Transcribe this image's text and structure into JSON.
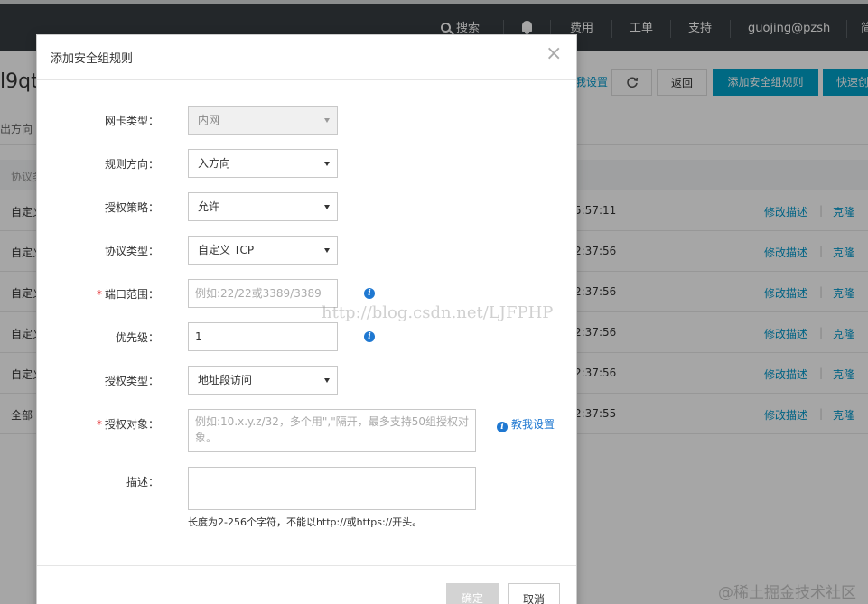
{
  "topbar": {
    "search": "搜索",
    "cost": "费用",
    "ticket": "工单",
    "support": "支持",
    "user": "guojing@pzsh",
    "extra": "简"
  },
  "background": {
    "title_fragment": "l9qt",
    "tab_fragment": "出方向",
    "thead_fragment": "协议类",
    "toolbar": {
      "settings_link": "我设置",
      "back": "返回",
      "add_rule": "添加安全组规则",
      "quick": "快速创"
    },
    "rows": [
      {
        "c1": "自定义",
        "time": "5:57:11",
        "edit": "修改描述",
        "clone": "克隆"
      },
      {
        "c1": "自定义",
        "time": "2:37:56",
        "edit": "修改描述",
        "clone": "克隆"
      },
      {
        "c1": "自定义",
        "time": "2:37:56",
        "edit": "修改描述",
        "clone": "克隆"
      },
      {
        "c1": "自定义",
        "time": "2:37:56",
        "edit": "修改描述",
        "clone": "克隆"
      },
      {
        "c1": "自定义",
        "time": "2:37:56",
        "edit": "修改描述",
        "clone": "克隆"
      },
      {
        "c1": "全部",
        "time": "2:37:55",
        "edit": "修改描述",
        "clone": "克隆"
      }
    ],
    "separator": "|"
  },
  "modal": {
    "title": "添加安全组规则",
    "close": "×",
    "fields": {
      "nic_type": {
        "label": "网卡类型：",
        "value": "内网"
      },
      "direction": {
        "label": "规则方向：",
        "value": "入方向"
      },
      "policy": {
        "label": "授权策略：",
        "value": "允许"
      },
      "protocol": {
        "label": "协议类型：",
        "value": "自定义 TCP"
      },
      "port_range": {
        "label": "端口范围：",
        "placeholder": "例如:22/22或3389/3389",
        "required": "*"
      },
      "priority": {
        "label": "优先级：",
        "value": "1"
      },
      "auth_type": {
        "label": "授权类型：",
        "value": "地址段访问"
      },
      "auth_object": {
        "label": "授权对象：",
        "placeholder": "例如:10.x.y.z/32，多个用\",\"隔开，最多支持50组授权对象。",
        "required": "*"
      },
      "description": {
        "label": "描述：",
        "hint": "长度为2-256个字符，不能以http://或https://开头。"
      }
    },
    "info_glyph": "i",
    "teach_link": "教我设置",
    "ok": "确定",
    "cancel": "取消"
  },
  "watermarks": {
    "blog": "http://blog.csdn.net/LJFPHP",
    "juejin": "@稀土掘金技术社区"
  }
}
